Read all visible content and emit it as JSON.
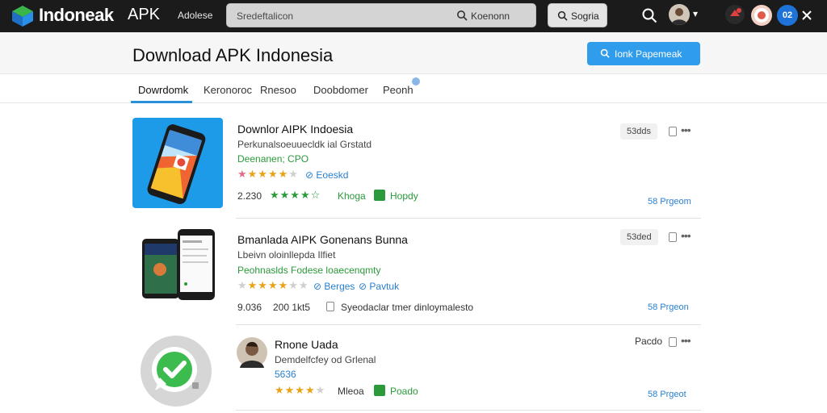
{
  "topbar": {
    "brand": "Indoneak",
    "brand_suffix": "APK",
    "nav_link": "Adolese",
    "search_placeholder": "Sredeftalicon",
    "search_hint": "Koenonn",
    "search_button": "Sogria",
    "chevron": "▾",
    "icon_badge_text": "02"
  },
  "header": {
    "title": "Download APK Indonesia",
    "primary_button": "Ionk Papemeak"
  },
  "tabs": [
    {
      "label": "Dowrdomk",
      "active": true
    },
    {
      "label": "Keronoroc",
      "active": false
    },
    {
      "label": "Rnesoo",
      "active": false
    },
    {
      "label": "Doobdomer",
      "active": false
    },
    {
      "label": "Peonh",
      "active": false
    }
  ],
  "apps": [
    {
      "title": "Downlor AIPK Indoesia",
      "subtitle": "Perkunalsoeuuecldk ial Grstatd",
      "category": "Deenanen; CPO",
      "rating_link": "Eoeskd",
      "downloads": "2.230",
      "tag_green": "Khoga",
      "tag_green_2": "Hopdy",
      "size": "53dds",
      "right_link": "58 Prgeom"
    },
    {
      "title": "Bmanlada AIPK Gonenans Bunna",
      "subtitle": "Lbeivn oloinllepda Ilfiet",
      "category": "Peohnaslds Fodese loaecenqmty",
      "rating_link": "Berges",
      "rating_link_2": "Pavtuk",
      "downloads": "9.036",
      "meta": "200 1kt5",
      "description": "Syeodaclar tmer dinloymalesto",
      "size": "53ded",
      "right_link": "58 Prgeon"
    },
    {
      "title": "Rnone Uada",
      "subtitle": "Demdelfcfey od Grlenal",
      "category": "5636",
      "tag_green": "Mleoa",
      "tag_green_2": "Poado",
      "size": "Pacdo",
      "right_link": "58 Prgeot"
    }
  ],
  "colors": {
    "accent": "#2f9cec",
    "topbar": "#1b1b1b",
    "green": "#2b9a3a",
    "link": "#2a7fd0"
  }
}
